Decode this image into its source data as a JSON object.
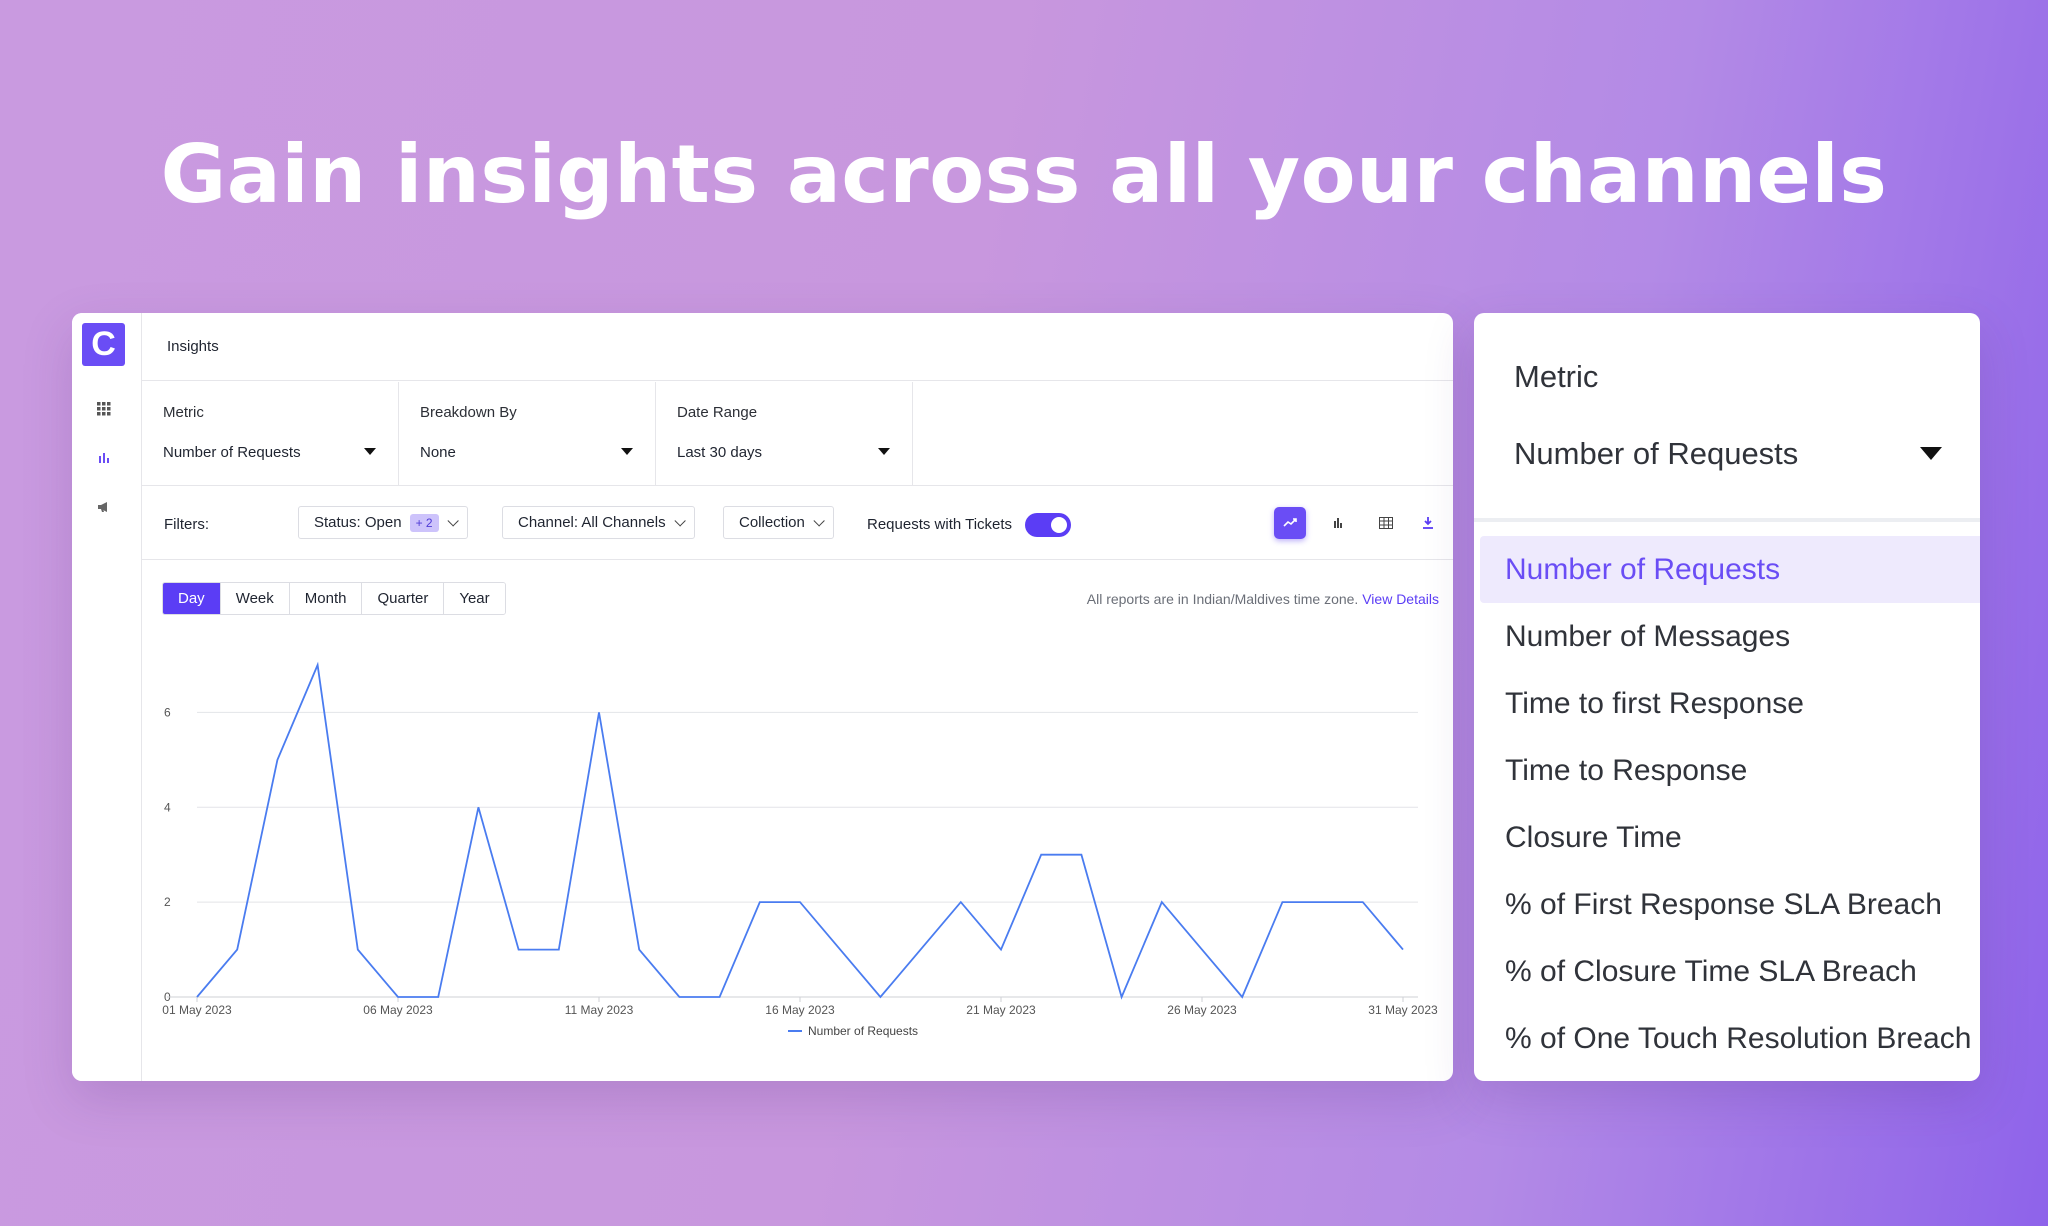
{
  "headline": "Gain insights across all your channels",
  "app": {
    "logo_letter": "C",
    "sidebar_icons": [
      "grid-icon",
      "bar-chart-icon",
      "megaphone-icon"
    ],
    "page_title": "Insights",
    "selectors": [
      {
        "label": "Metric",
        "value": "Number of Requests"
      },
      {
        "label": "Breakdown By",
        "value": "None"
      },
      {
        "label": "Date Range",
        "value": "Last 30 days"
      }
    ],
    "filters": {
      "label": "Filters:",
      "status": "Status: Open",
      "status_extra": "+ 2",
      "channel": "Channel: All Channels",
      "collection": "Collection",
      "toggle_label": "Requests with Tickets",
      "toggle_on": true
    },
    "view_buttons": [
      "line-chart-icon",
      "bar-chart-icon",
      "table-icon",
      "download-icon"
    ],
    "period_tabs": [
      "Day",
      "Week",
      "Month",
      "Quarter",
      "Year"
    ],
    "active_period": "Day",
    "tz_note": "All reports are in Indian/Maldives time zone.",
    "tz_link": "View Details",
    "accent": "#5b3df5"
  },
  "chart_data": {
    "type": "line",
    "x": [
      "01 May 2023",
      "02 May 2023",
      "03 May 2023",
      "04 May 2023",
      "05 May 2023",
      "06 May 2023",
      "07 May 2023",
      "08 May 2023",
      "09 May 2023",
      "10 May 2023",
      "11 May 2023",
      "12 May 2023",
      "13 May 2023",
      "14 May 2023",
      "15 May 2023",
      "16 May 2023",
      "17 May 2023",
      "18 May 2023",
      "19 May 2023",
      "20 May 2023",
      "21 May 2023",
      "22 May 2023",
      "23 May 2023",
      "24 May 2023",
      "25 May 2023",
      "26 May 2023",
      "27 May 2023",
      "28 May 2023",
      "29 May 2023",
      "30 May 2023",
      "31 May 2023"
    ],
    "x_tick_labels": [
      "01 May 2023",
      "06 May 2023",
      "11 May 2023",
      "16 May 2023",
      "21 May 2023",
      "26 May 2023",
      "31 May 2023"
    ],
    "series": [
      {
        "name": "Number of Requests",
        "values": [
          0,
          1,
          5,
          7,
          1,
          0,
          0,
          4,
          1,
          1,
          6,
          1,
          0,
          0,
          2,
          2,
          1,
          0,
          1,
          2,
          1,
          3,
          3,
          0,
          2,
          1,
          0,
          2,
          2,
          2,
          1
        ],
        "color": "#4a7cf0"
      }
    ],
    "y_ticks": [
      0,
      2,
      4,
      6
    ],
    "ylim": [
      0,
      7
    ],
    "grid": true,
    "legend": "bottom"
  },
  "metric_panel": {
    "label": "Metric",
    "value": "Number of Requests",
    "options": [
      "Number of Requests",
      "Number of Messages",
      "Time to first Response",
      "Time to Response",
      "Closure Time",
      "% of First Response SLA Breach",
      "% of Closure Time SLA Breach",
      "% of One Touch Resolution Breach"
    ],
    "selected": "Number of Requests"
  }
}
